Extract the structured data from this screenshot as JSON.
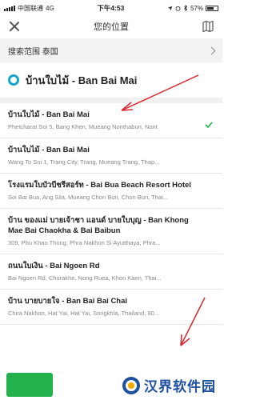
{
  "status_bar": {
    "carrier": "中国联通",
    "network": "4G",
    "time": "下午4:53",
    "battery": "57%"
  },
  "nav": {
    "title": "您的位置",
    "close_icon": "close-icon",
    "map_icon": "map-icon"
  },
  "scope": {
    "label": "搜索范围 泰国"
  },
  "search": {
    "query": "บ้านใบไม้ - Ban Bai Mai"
  },
  "results": [
    {
      "title": "บ้านใบไม้ - Ban Bai Mai",
      "address": "Phetcharat Soi 5, Bang Khen, Mueang Nonthaburi, Nont",
      "selected": true
    },
    {
      "title": "บ้านใบไม้ - Ban Bai Mai",
      "address": "Wang To Soi 1, Trang City, Trang, Mueang Trang, Thap...",
      "selected": false
    },
    {
      "title": "โรงแรมใบบัวบีชรีสอร์ท - Bai Bua Beach Resort Hotel",
      "address": "Soi Bai Bua, Ang Sila, Mueang Chon Buri, Chon Buri, Thai...",
      "selected": false
    },
    {
      "title": "บ้าน ของแม่ บายเจ้าชา แอนด์ บายใบบุญ - Ban Khong Mae Bai Chaokha & Bai Baibun",
      "address": "309, Phu Khao Thong, Phra Nakhon Si Ayutthaya, Phra...",
      "selected": false
    },
    {
      "title": "ถนนใบเงิน - Bai Ngoen Rd",
      "address": "Bai Ngoen Rd, Chorakhe, Nong Ruea, Khon Kaen, Thai...",
      "selected": false
    },
    {
      "title": "บ้าน บายบายใจ - Ban Bai Bai Chai",
      "address": "Chira Nakhon, Hat Yai, Hat Yai, Songkhla, Thailand, 90...",
      "selected": false
    }
  ],
  "watermark": {
    "text": "汉界软件园"
  },
  "colors": {
    "accent": "#14a6c9",
    "check": "#22b14c",
    "annotation": "#d9262e"
  }
}
